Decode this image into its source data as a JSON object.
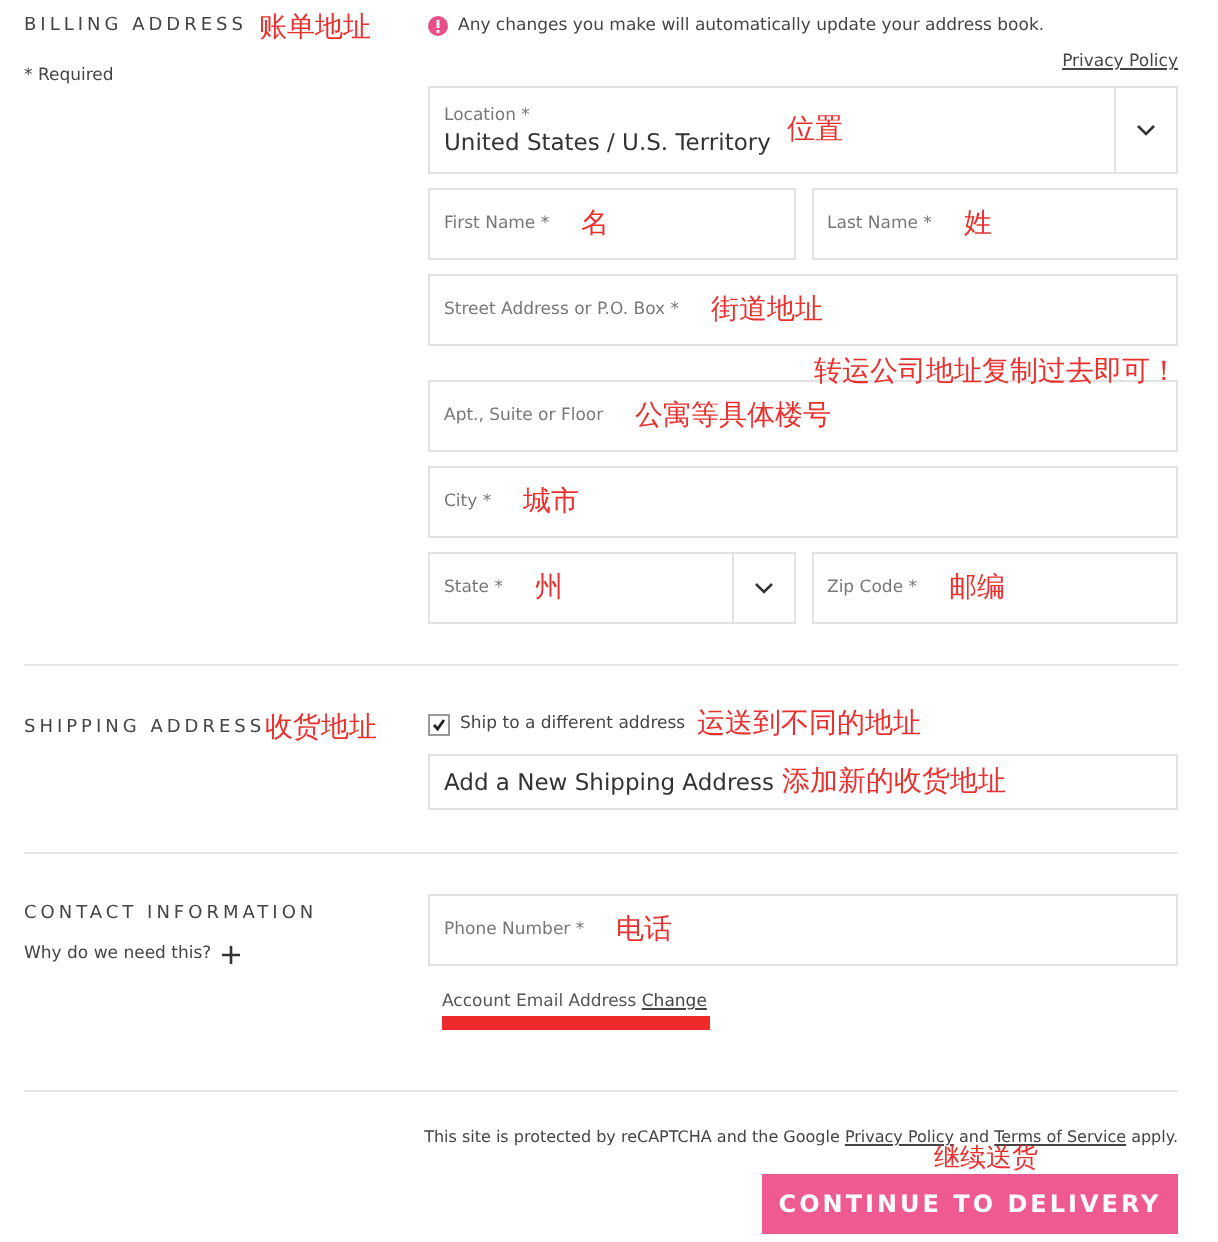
{
  "billing": {
    "heading": "BILLING ADDRESS",
    "annotation": "账单地址",
    "required_note": "* Required",
    "notice": "Any changes you make will automatically update your address book.",
    "privacy_link": "Privacy Policy",
    "rows": [
      {
        "kind": "fields",
        "fields": [
          {
            "kind": "select",
            "label": "Location *",
            "value": "United States / U.S. Territory",
            "annotation": "位置"
          }
        ]
      },
      {
        "kind": "fields",
        "fields": [
          {
            "kind": "text",
            "label": "First Name *",
            "annotation": "名"
          },
          {
            "kind": "text",
            "label": "Last Name *",
            "annotation": "姓"
          }
        ]
      },
      {
        "kind": "fields",
        "fields": [
          {
            "kind": "text",
            "label": "Street Address or P.O. Box *",
            "annotation": "街道地址"
          }
        ]
      },
      {
        "kind": "note",
        "text": "转运公司地址复制过去即可！"
      },
      {
        "kind": "fields",
        "fields": [
          {
            "kind": "text",
            "label": "Apt., Suite or Floor",
            "annotation": "公寓等具体楼号"
          }
        ]
      },
      {
        "kind": "fields",
        "fields": [
          {
            "kind": "text",
            "label": "City *",
            "annotation": "城市"
          }
        ]
      },
      {
        "kind": "fields",
        "fields": [
          {
            "kind": "select",
            "label": "State *",
            "annotation": "州"
          },
          {
            "kind": "text",
            "label": "Zip Code *",
            "annotation": "邮编"
          }
        ]
      }
    ]
  },
  "shipping": {
    "heading": "SHIPPING ADDRESS",
    "annotation": "收货地址",
    "checkbox": {
      "label": "Ship to a different address",
      "checked": true,
      "annotation": "运送到不同的地址"
    },
    "field": {
      "value": "Add a New Shipping Address",
      "annotation": "添加新的收货地址"
    }
  },
  "contact": {
    "heading": "CONTACT INFORMATION",
    "help": "Why do we need this?",
    "phone": {
      "label": "Phone Number *",
      "annotation": "电话"
    },
    "email_label": "Account Email Address",
    "email_link": "Change"
  },
  "footer": {
    "recaptcha": [
      "This site is protected by reCAPTCHA and the Google ",
      "Privacy Policy",
      " and ",
      "Terms of Service",
      " apply."
    ],
    "annotation": "继续送货",
    "button": "CONTINUE TO DELIVERY"
  }
}
